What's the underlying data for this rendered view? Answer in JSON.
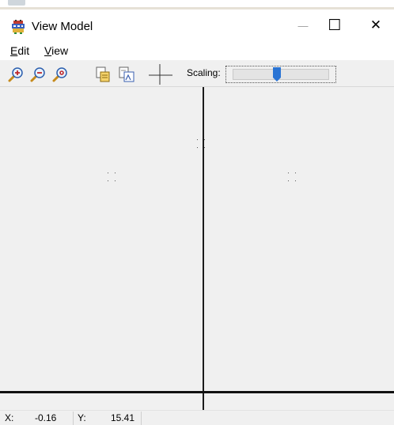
{
  "window": {
    "title": "View Model",
    "minimize_glyph": "—",
    "maximize_glyph": "☐",
    "close_glyph": "✕"
  },
  "menu": {
    "items": [
      {
        "label_first": "E",
        "label_rest": "dit"
      },
      {
        "label_first": "V",
        "label_rest": "iew"
      }
    ]
  },
  "toolbar": {
    "buttons": [
      {
        "icon": "zoom-in-icon"
      },
      {
        "icon": "zoom-out-icon"
      },
      {
        "icon": "zoom-reset-icon"
      },
      {
        "icon": "copy-icon"
      },
      {
        "icon": "copy-scaled-icon"
      },
      {
        "icon": "crosshair-icon"
      }
    ],
    "scaling_label": "Scaling:",
    "scaling_value": 0.45,
    "accent_color": "#2a74d4"
  },
  "status": {
    "x_label": "X:",
    "x_value": "-0.16",
    "y_label": "Y:",
    "y_value": "15.41"
  }
}
